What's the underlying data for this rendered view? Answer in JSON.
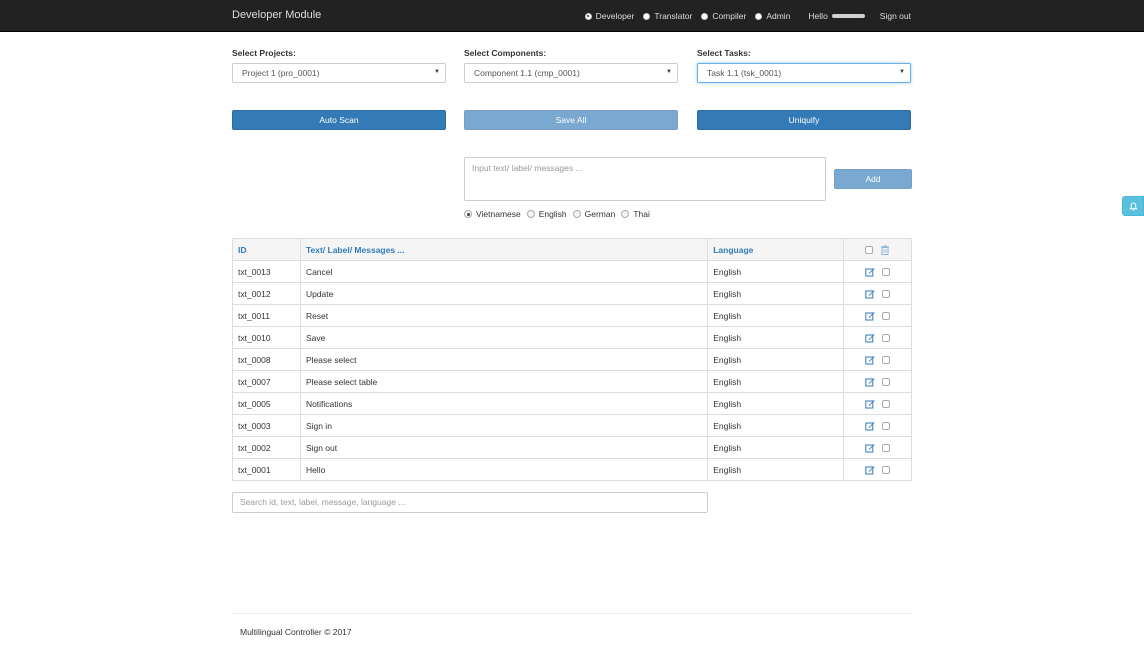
{
  "navbar": {
    "brand": "Developer Module",
    "roles": [
      {
        "label": "Developer",
        "checked": true
      },
      {
        "label": "Translator",
        "checked": false
      },
      {
        "label": "Compiler",
        "checked": false
      },
      {
        "label": "Admin",
        "checked": false
      }
    ],
    "hello": "Hello",
    "signout": "Sign out"
  },
  "selects": {
    "projects": {
      "label": "Select Projects:",
      "value": "Project 1 (pro_0001)"
    },
    "components": {
      "label": "Select Components:",
      "value": "Component 1.1 (cmp_0001)"
    },
    "tasks": {
      "label": "Select Tasks:",
      "value": "Task 1.1 (tsk_0001)"
    }
  },
  "buttons": {
    "auto_scan": "Auto Scan",
    "save_all": "Save All",
    "uniquify": "Uniquify",
    "add": "Add"
  },
  "input": {
    "placeholder": "Input text/ label/ messages ..."
  },
  "languages": [
    {
      "label": "Vietnamese",
      "checked": true
    },
    {
      "label": "English",
      "checked": false
    },
    {
      "label": "German",
      "checked": false
    },
    {
      "label": "Thai",
      "checked": false
    }
  ],
  "table": {
    "headers": {
      "id": "ID",
      "text": "Text/ Label/ Messages ...",
      "language": "Language"
    },
    "rows": [
      {
        "id": "txt_0013",
        "text": "Cancel",
        "language": "English"
      },
      {
        "id": "txt_0012",
        "text": "Update",
        "language": "English"
      },
      {
        "id": "txt_0011",
        "text": "Reset",
        "language": "English"
      },
      {
        "id": "txt_0010",
        "text": "Save",
        "language": "English"
      },
      {
        "id": "txt_0008",
        "text": "Please select",
        "language": "English"
      },
      {
        "id": "txt_0007",
        "text": "Please select table",
        "language": "English"
      },
      {
        "id": "txt_0005",
        "text": "Notifications",
        "language": "English"
      },
      {
        "id": "txt_0003",
        "text": "Sign in",
        "language": "English"
      },
      {
        "id": "txt_0002",
        "text": "Sign out",
        "language": "English"
      },
      {
        "id": "txt_0001",
        "text": "Hello",
        "language": "English"
      }
    ]
  },
  "search": {
    "placeholder": "Search id, text, label, message, language ..."
  },
  "footer": "Multilingual Controller © 2017",
  "colors": {
    "primary": "#337ab7",
    "navbar": "#222222",
    "info": "#5bc0de"
  }
}
